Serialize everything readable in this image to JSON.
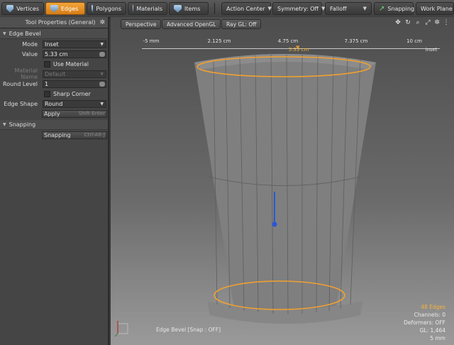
{
  "toolbar": {
    "modes": [
      {
        "label": "Vertices",
        "icon": "vertices-icon",
        "active": false
      },
      {
        "label": "Edges",
        "icon": "edges-icon",
        "active": true
      },
      {
        "label": "Polygons",
        "icon": "polygons-icon",
        "active": false
      },
      {
        "label": "Materials",
        "icon": "materials-icon",
        "active": false
      },
      {
        "label": "Items",
        "icon": "items-icon",
        "active": false
      }
    ],
    "action_center": "Action Center",
    "symmetry": "Symmetry: Off",
    "falloff": "Falloff",
    "snapping": "Snapping",
    "work_plane": "Work Plane"
  },
  "panel": {
    "title": "Tool Properties (General)",
    "edge_bevel": {
      "section": "Edge Bevel",
      "mode_label": "Mode",
      "mode_value": "Inset",
      "value_label": "Value",
      "value_value": "5.33 cm",
      "use_material_label": "Use Material",
      "material_name_label": "Material Name",
      "material_name_value": "Default",
      "round_level_label": "Round Level",
      "round_level_value": "1",
      "sharp_corner_label": "Sharp Corner",
      "edge_shape_label": "Edge Shape",
      "edge_shape_value": "Round",
      "apply_label": "Apply",
      "apply_hint": "Shift-Enter"
    },
    "snapping": {
      "section": "Snapping",
      "button_label": "Snapping",
      "button_hint": "Ctrl-Alt-J"
    }
  },
  "viewport": {
    "view": "Perspective",
    "shading": "Advanced OpenGL",
    "raygl": "Ray GL: Off",
    "ruler_ticks": [
      "-5 mm",
      "2.125 cm",
      "4.75 cm",
      "7.375 cm",
      "10 cm"
    ],
    "ruler_suffix": "inset",
    "ruler_value": "5.33 cm",
    "status_tool": "Edge Bevel",
    "status_snap": "[Snap : OFF]",
    "stats": {
      "edges": "48 Edges",
      "channels": "Channels: 0",
      "deformers": "Deformers: OFF",
      "gl": "GL: 1,464",
      "unit": "5 mm"
    }
  },
  "colors": {
    "accent": "#e8982e",
    "selection": "#f0a030",
    "handle": "#2b55d9"
  }
}
